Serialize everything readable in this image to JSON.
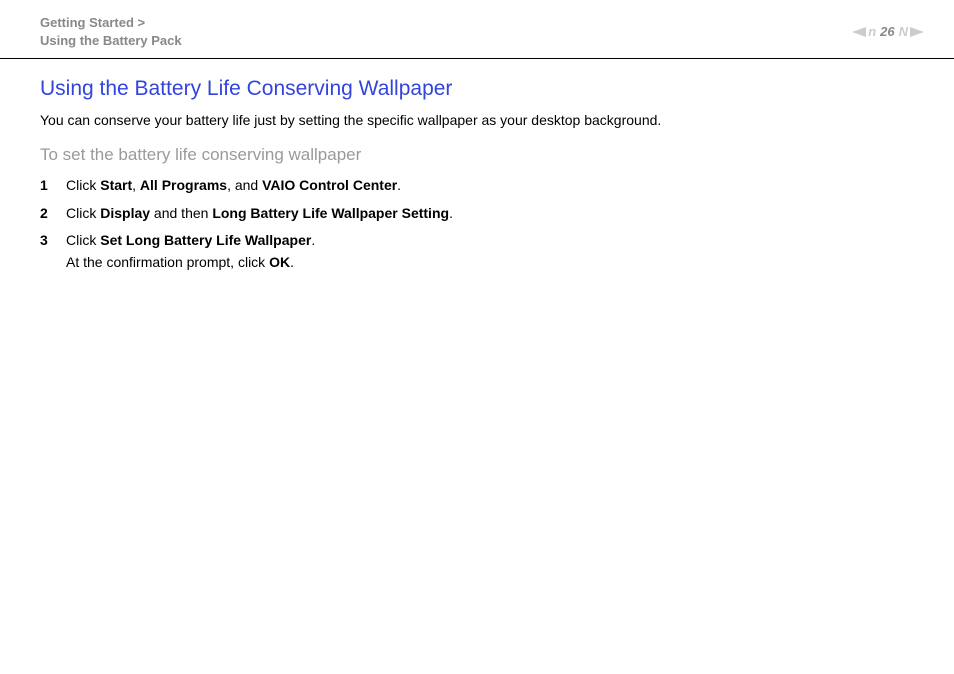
{
  "breadcrumb": {
    "line1": "Getting Started >",
    "line2": "Using the Battery Pack"
  },
  "page_number": "26",
  "title": "Using the Battery Life Conserving Wallpaper",
  "intro": "You can conserve your battery life just by setting the specific wallpaper as your desktop background.",
  "subheading": "To set the battery life conserving wallpaper",
  "steps": {
    "s1": {
      "pre": "Click ",
      "b1": "Start",
      "sep1": ", ",
      "b2": "All Programs",
      "sep2": ", and ",
      "b3": "VAIO Control Center",
      "post": "."
    },
    "s2": {
      "pre": "Click ",
      "b1": "Display",
      "mid": " and then ",
      "b2": "Long Battery Life Wallpaper Setting",
      "post": "."
    },
    "s3": {
      "pre": "Click ",
      "b1": "Set Long Battery Life Wallpaper",
      "post1": ".",
      "line2a": "At the confirmation prompt, click ",
      "b2": "OK",
      "post2": "."
    }
  }
}
